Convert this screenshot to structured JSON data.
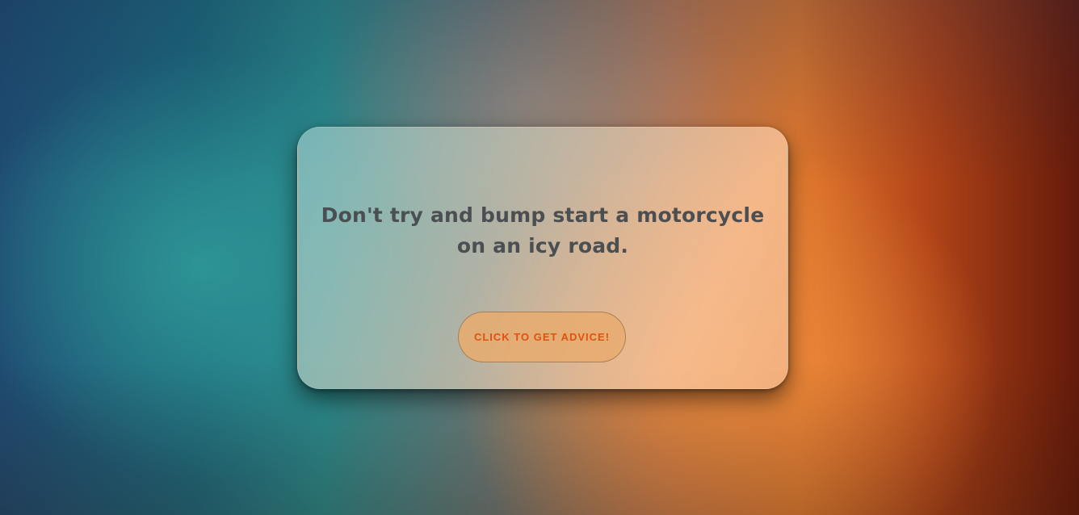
{
  "card": {
    "advice_text": "Don't try and bump start a motorcycle on an icy road.",
    "button_label": "CLICK TO GET ADVICE!"
  },
  "colors": {
    "advice_text": "#4b4f52",
    "button_text": "#e0520f",
    "button_fill": "#e8ac6e"
  }
}
